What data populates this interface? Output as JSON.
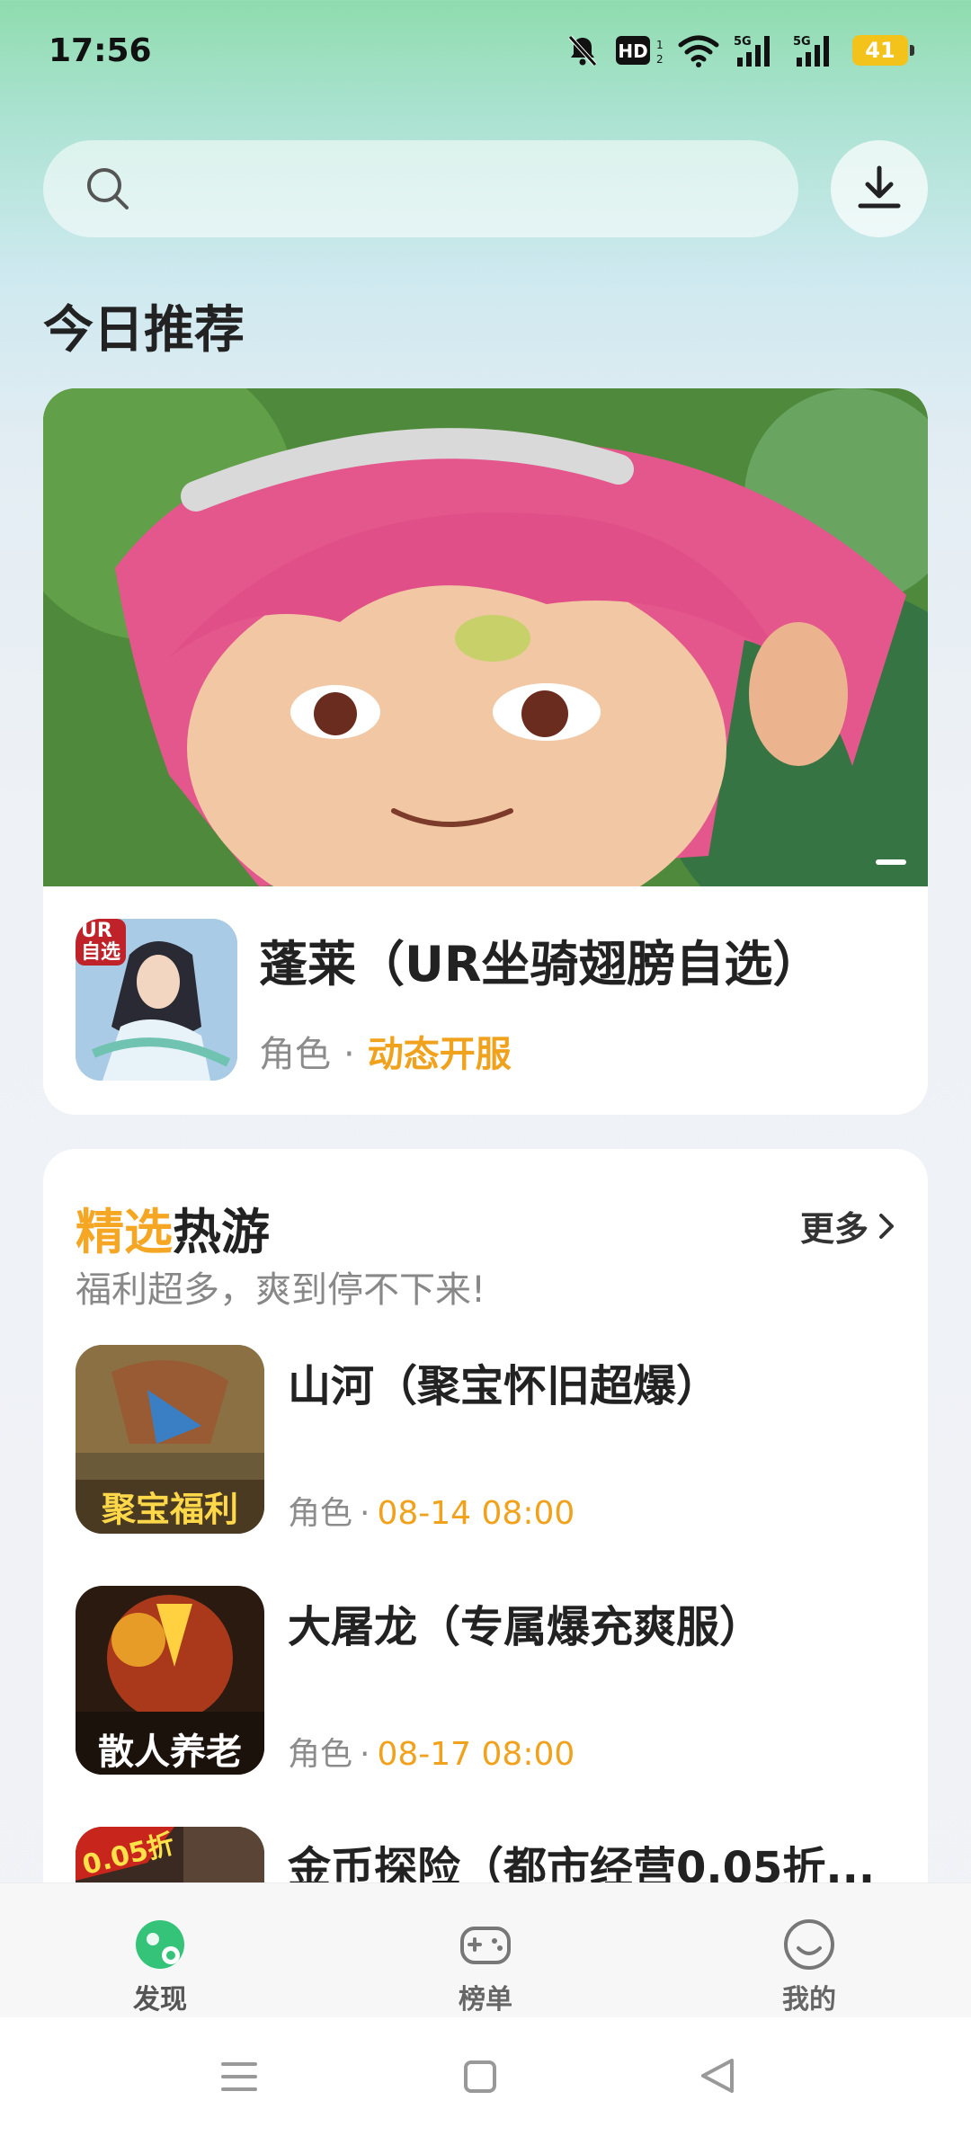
{
  "status_bar": {
    "time": "17:56",
    "battery": "41"
  },
  "header": {
    "section_title": "今日推荐"
  },
  "featured": {
    "name": "蓬莱（UR坐骑翅膀自选）",
    "category": "角色",
    "separator": "·",
    "tag": "动态开服",
    "icon_badge": "UR自选"
  },
  "hot_section": {
    "title_highlight": "精选",
    "title_rest": "热游",
    "subtitle": "福利超多，爽到停不下来!",
    "more_label": "更多",
    "games": [
      {
        "name": "山河（聚宝怀旧超爆）",
        "category": "角色",
        "separator": "·",
        "time": "08-14 08:00",
        "icon_text": "聚宝福利"
      },
      {
        "name": "大屠龙（专属爆充爽服）",
        "category": "角色",
        "separator": "·",
        "time": "08-17 08:00",
        "icon_text": "散人养老"
      },
      {
        "name": "金币探险（都市经营0.05折...",
        "category": "",
        "separator": "",
        "time": "",
        "icon_text": "0.05折"
      }
    ]
  },
  "bottom_nav": {
    "items": [
      {
        "label": "发现"
      },
      {
        "label": "榜单"
      },
      {
        "label": "我的"
      }
    ]
  },
  "colors": {
    "accent": "#f0a21d",
    "brand_green": "#2bbf6e"
  }
}
